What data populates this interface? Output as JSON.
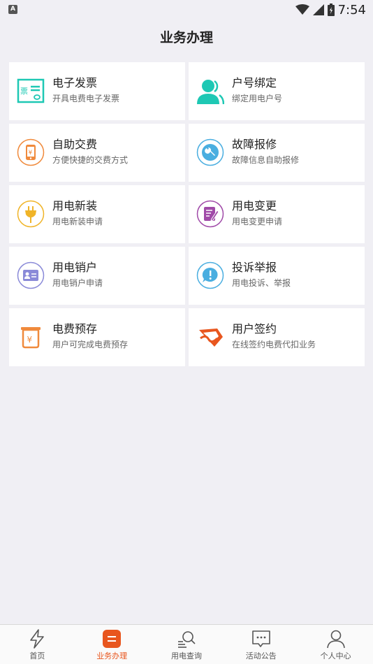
{
  "status": {
    "time": "7:54",
    "badge": "A"
  },
  "header": {
    "title": "业务办理"
  },
  "services": [
    {
      "title": "电子发票",
      "subtitle": "开具电费电子发票",
      "icon": "invoice-icon"
    },
    {
      "title": "户号绑定",
      "subtitle": "绑定用电户号",
      "icon": "user-bind-icon"
    },
    {
      "title": "自助交费",
      "subtitle": "方便快捷的交费方式",
      "icon": "self-payment-icon"
    },
    {
      "title": "故障报修",
      "subtitle": "故障信息自助报修",
      "icon": "wrench-icon"
    },
    {
      "title": "用电新装",
      "subtitle": "用电新装申请",
      "icon": "plug-icon"
    },
    {
      "title": "用电变更",
      "subtitle": "用电变更申请",
      "icon": "edit-document-icon"
    },
    {
      "title": "用电销户",
      "subtitle": "用电销户申请",
      "icon": "id-card-icon"
    },
    {
      "title": "投诉举报",
      "subtitle": "用电投诉、举报",
      "icon": "complaint-icon"
    },
    {
      "title": "电费预存",
      "subtitle": "用户可完成电费预存",
      "icon": "prepay-icon"
    },
    {
      "title": "用户签约",
      "subtitle": "在线签约电费代扣业务",
      "icon": "sign-contract-icon"
    }
  ],
  "colors": {
    "accent": "#e8561e",
    "teal": "#1ec8b4",
    "orange": "#f08a3c",
    "blue": "#4aaee0",
    "yellow": "#f0b428",
    "purple": "#a04aa8",
    "lilac": "#8a8ad8"
  },
  "tabs": [
    {
      "label": "首页",
      "icon": "lightning-icon"
    },
    {
      "label": "业务办理",
      "icon": "business-icon",
      "active": true
    },
    {
      "label": "用电查询",
      "icon": "search-list-icon"
    },
    {
      "label": "活动公告",
      "icon": "chat-bubble-icon"
    },
    {
      "label": "个人中心",
      "icon": "person-icon"
    }
  ]
}
